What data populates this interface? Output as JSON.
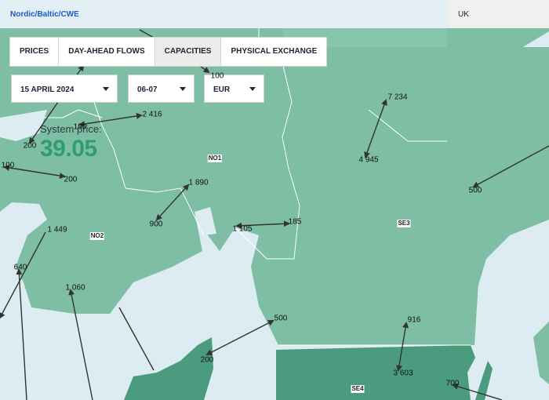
{
  "header": {
    "region_link": "Nordic/Baltic/CWE",
    "uk_label": "UK"
  },
  "tabs": [
    {
      "label": "PRICES",
      "active": false
    },
    {
      "label": "DAY-AHEAD FLOWS",
      "active": false
    },
    {
      "label": "CAPACITIES",
      "active": true
    },
    {
      "label": "PHYSICAL EXCHANGE",
      "active": false
    }
  ],
  "filters": {
    "date": "15 APRIL 2024",
    "hour": "06-07",
    "currency": "EUR"
  },
  "system_price": {
    "label": "System price:",
    "value": "39.05"
  },
  "zones": [
    "NO1",
    "NO2",
    "SE3",
    "SE4"
  ],
  "capacities": [
    "100",
    "2 416",
    "190",
    "200",
    "100",
    "200",
    "1 890",
    "900",
    "7 234",
    "4 945",
    "500",
    "185",
    "1 105",
    "1 449",
    "640",
    "1 060",
    "500",
    "200",
    "916",
    "3 603",
    "700"
  ],
  "colors": {
    "sea": "#dcecf2",
    "land": "#7dbea5",
    "land_light": "#87c5ad",
    "se4": "#4b9b7f",
    "price_green": "#2f9e6e",
    "link_blue": "#1a5cc8"
  }
}
